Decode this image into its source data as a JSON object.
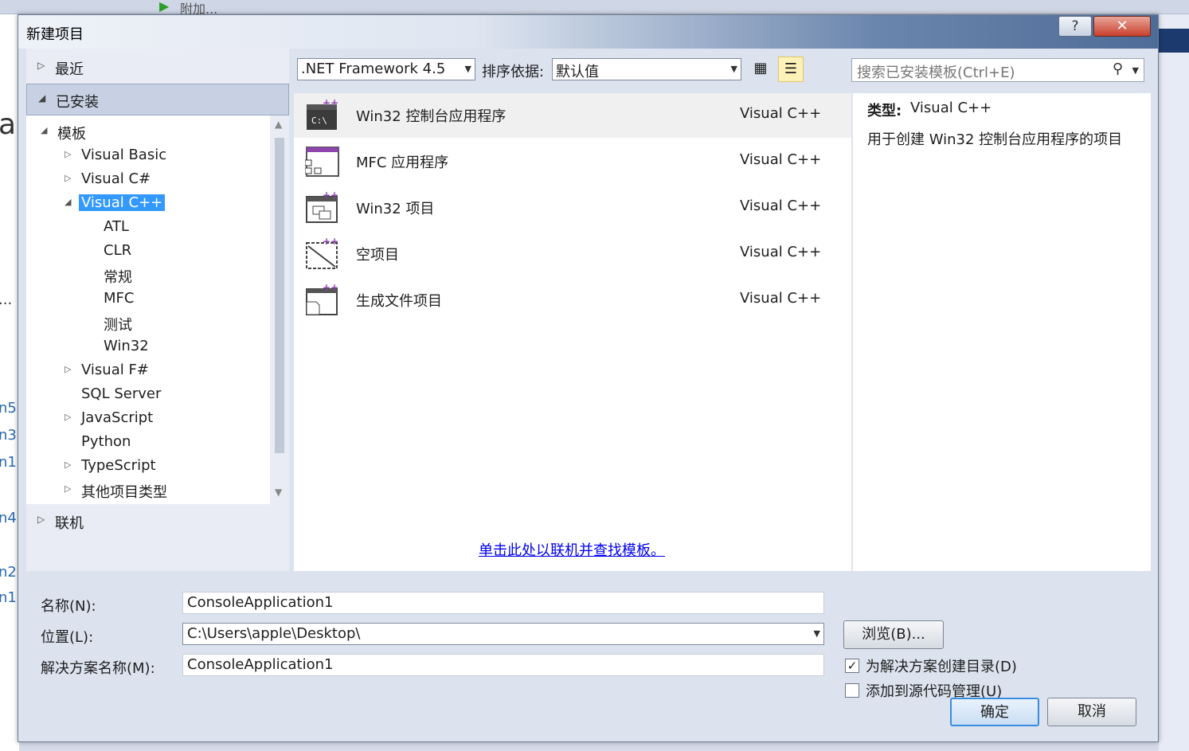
{
  "ide": {
    "toolbar_attach": "附加...",
    "left_fragments": [
      "al",
      "...",
      "n5",
      "n3",
      "n1",
      "n4",
      "n2",
      "n1"
    ]
  },
  "dialog": {
    "title": "新建项目",
    "help_button": "?",
    "close_button": "✕"
  },
  "nav": {
    "recent": "最近",
    "installed": "已安装",
    "online": "联机",
    "tree": [
      {
        "label": "模板",
        "arrow": "◢"
      },
      {
        "label": "Visual Basic",
        "arrow": "▷"
      },
      {
        "label": "Visual C#",
        "arrow": "▷"
      },
      {
        "label": "Visual C++",
        "arrow": "◢",
        "selected": true
      },
      {
        "label": "ATL"
      },
      {
        "label": "CLR"
      },
      {
        "label": "常规"
      },
      {
        "label": "MFC"
      },
      {
        "label": "测试"
      },
      {
        "label": "Win32"
      },
      {
        "label": "Visual F#",
        "arrow": "▷"
      },
      {
        "label": "SQL Server"
      },
      {
        "label": "JavaScript",
        "arrow": "▷"
      },
      {
        "label": "Python"
      },
      {
        "label": "TypeScript",
        "arrow": "▷"
      },
      {
        "label": "其他项目类型",
        "arrow": "▷"
      }
    ]
  },
  "toolbar": {
    "framework": ".NET Framework 4.5",
    "sort_label": "排序依据:",
    "sort_value": "默认值",
    "search_placeholder": "搜索已安装模板(Ctrl+E)"
  },
  "templates": [
    {
      "name": "Win32 控制台应用程序",
      "lang": "Visual C++",
      "icon": "console-app-icon"
    },
    {
      "name": "MFC 应用程序",
      "lang": "Visual C++",
      "icon": "mfc-app-icon"
    },
    {
      "name": "Win32 项目",
      "lang": "Visual C++",
      "icon": "win32-project-icon"
    },
    {
      "name": "空项目",
      "lang": "Visual C++",
      "icon": "empty-project-icon"
    },
    {
      "name": "生成文件项目",
      "lang": "Visual C++",
      "icon": "makefile-project-icon"
    }
  ],
  "online_link": "单击此处以联机并查找模板。",
  "details": {
    "type_label": "类型:",
    "type_value": "Visual C++",
    "description": "用于创建 Win32 控制台应用程序的项目"
  },
  "form": {
    "name_label": "名称(N):",
    "name_value": "ConsoleApplication1",
    "location_label": "位置(L):",
    "location_value": "C:\\Users\\apple\\Desktop\\",
    "solution_label": "解决方案名称(M):",
    "solution_value": "ConsoleApplication1",
    "browse_button": "浏览(B)...",
    "create_dir_label": "为解决方案创建目录(D)",
    "create_dir_checked": true,
    "source_control_label": "添加到源代码管理(U)",
    "source_control_checked": false,
    "ok_button": "确定",
    "cancel_button": "取消"
  },
  "colors": {
    "selection": "#3399ff",
    "link": "#0000ee",
    "cpp_purple": "#8e44ad"
  }
}
